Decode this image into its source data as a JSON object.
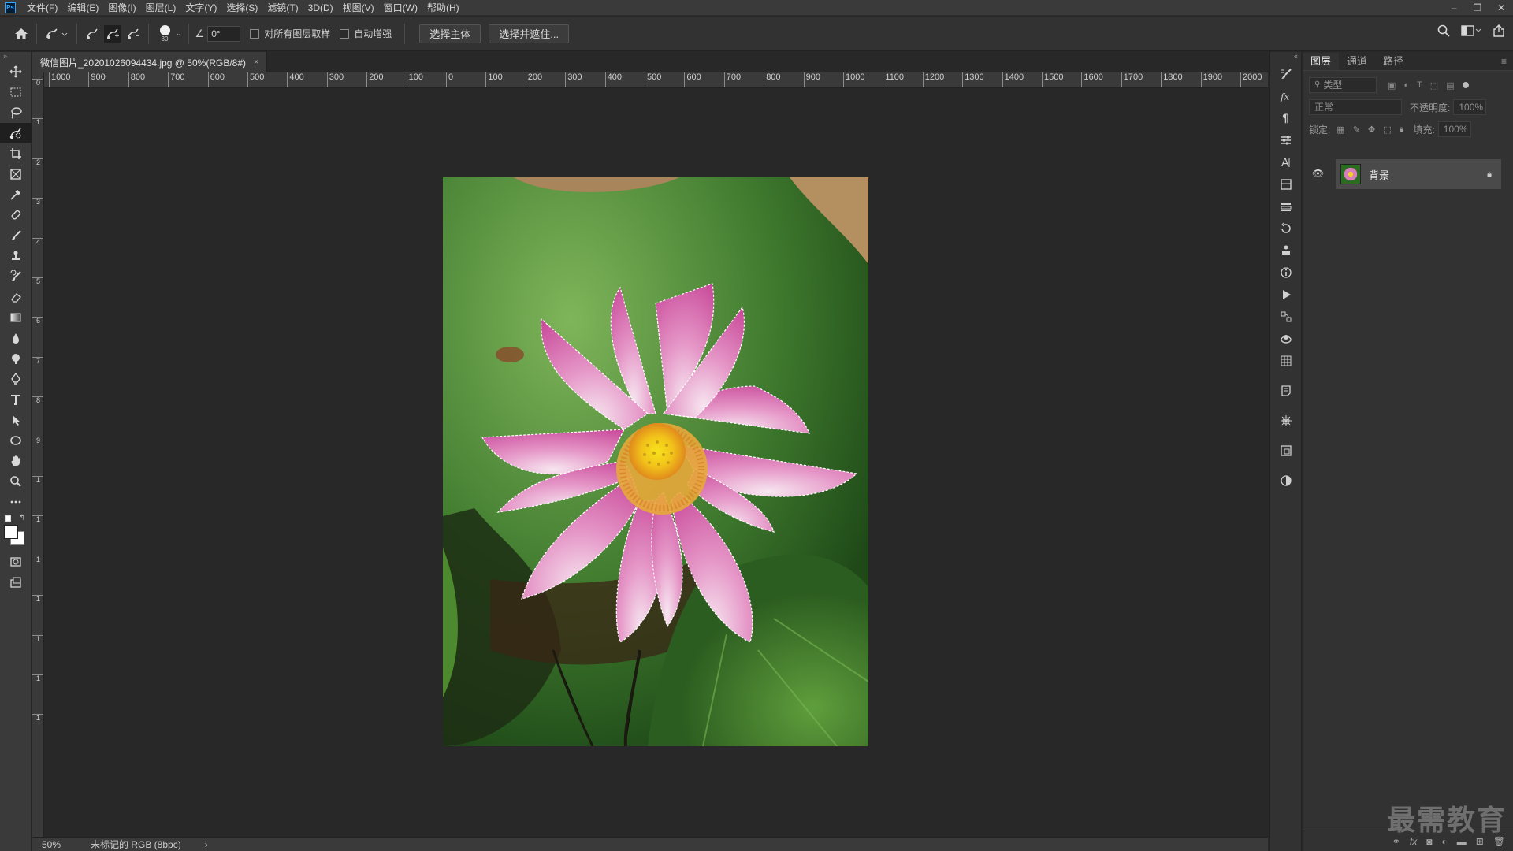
{
  "app": {
    "logo": "Ps"
  },
  "menu": [
    "文件(F)",
    "编辑(E)",
    "图像(I)",
    "图层(L)",
    "文字(Y)",
    "选择(S)",
    "滤镜(T)",
    "3D(D)",
    "视图(V)",
    "窗口(W)",
    "帮助(H)"
  ],
  "window_controls": {
    "minimize": "–",
    "restore": "❐",
    "close": "✕"
  },
  "options": {
    "brush_size": "30",
    "angle": "0°",
    "sample_all_layers": "对所有图层取样",
    "auto_enhance": "自动增强",
    "select_subject": "选择主体",
    "select_and_mask": "选择并遮住..."
  },
  "document": {
    "tab_title": "微信图片_20201026094434.jpg @ 50%(RGB/8#)",
    "close_glyph": "×"
  },
  "ruler_top": [
    "1000",
    "900",
    "800",
    "700",
    "600",
    "500",
    "400",
    "300",
    "200",
    "100",
    "0",
    "100",
    "200",
    "300",
    "400",
    "500",
    "600",
    "700",
    "800",
    "900",
    "1000",
    "1100",
    "1200",
    "1300",
    "1400",
    "1500",
    "1600",
    "1700",
    "1800",
    "1900",
    "2000"
  ],
  "ruler_left": [
    "0",
    "1",
    "2",
    "3",
    "4",
    "5",
    "6",
    "7",
    "8",
    "9",
    "1",
    "1",
    "1",
    "1",
    "1",
    "1",
    "1"
  ],
  "status": {
    "zoom": "50%",
    "profile": "未标记的 RGB (8bpc)",
    "arrow": "›"
  },
  "layers_panel": {
    "tabs": [
      "图层",
      "通道",
      "路径"
    ],
    "search_placeholder": "类型",
    "blend_mode": "正常",
    "opacity_label": "不透明度:",
    "opacity_value": "100%",
    "lock_label": "锁定:",
    "fill_label": "填充:",
    "fill_value": "100%",
    "layer_name": "背景"
  },
  "watermark": "最需教育",
  "colors": {
    "accent": "#31a8ff",
    "selection": "#ffffff"
  }
}
